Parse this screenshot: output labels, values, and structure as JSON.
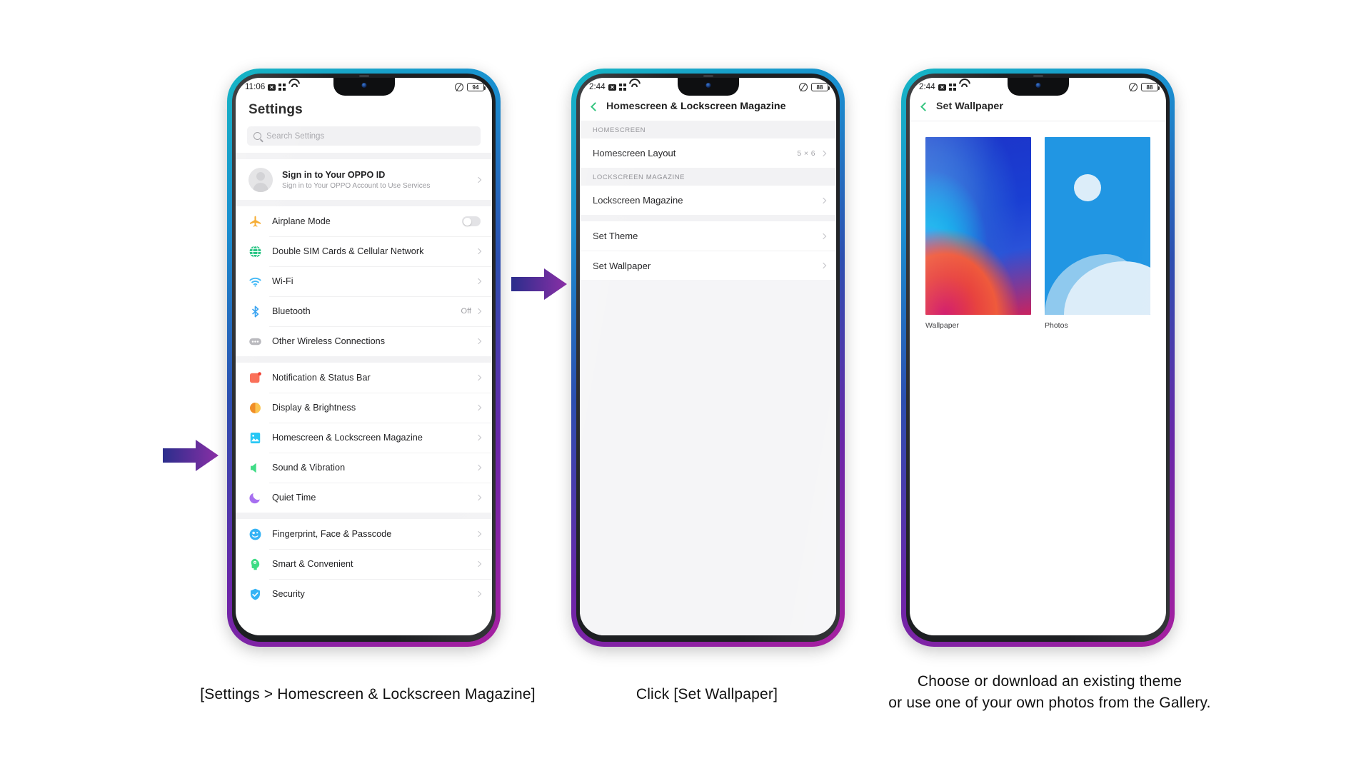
{
  "phones": [
    {
      "id": "phone-settings",
      "status": {
        "time": "11:06",
        "battery": "94",
        "icons": [
          "sms-icon",
          "qr-icon",
          "wifi-icon",
          "silent-mode-icon",
          "battery-icon"
        ]
      },
      "title": "Settings",
      "search": {
        "placeholder": "Search Settings"
      },
      "account": {
        "title": "Sign in to Your OPPO ID",
        "subtitle": "Sign in to Your OPPO Account to Use Services"
      },
      "groups": [
        {
          "items": [
            {
              "label": "Airplane Mode",
              "icon": "airplane-icon",
              "color": "#f5a623",
              "control": "toggle",
              "value": ""
            },
            {
              "label": "Double SIM Cards & Cellular Network",
              "icon": "globe-icon",
              "color": "#18c07a",
              "control": "chevron",
              "value": ""
            },
            {
              "label": "Wi-Fi",
              "icon": "wifi-icon",
              "color": "#35b3f5",
              "control": "chevron",
              "value": ""
            },
            {
              "label": "Bluetooth",
              "icon": "bluetooth-icon",
              "color": "#2f9ff0",
              "control": "chevron",
              "value": "Off"
            },
            {
              "label": "Other Wireless Connections",
              "icon": "dots-icon",
              "color": "#b6b6bb",
              "control": "chevron",
              "value": ""
            }
          ]
        },
        {
          "items": [
            {
              "label": "Notification & Status Bar",
              "icon": "notification-icon",
              "color": "#fa6a52",
              "control": "chevron",
              "value": ""
            },
            {
              "label": "Display & Brightness",
              "icon": "brightness-icon",
              "color": "#f5a623",
              "control": "chevron",
              "value": ""
            },
            {
              "label": "Homescreen & Lockscreen Magazine",
              "icon": "wallpaper-icon",
              "color": "#23c6f5",
              "control": "chevron",
              "value": ""
            },
            {
              "label": "Sound & Vibration",
              "icon": "sound-icon",
              "color": "#3ddc84",
              "control": "chevron",
              "value": ""
            },
            {
              "label": "Quiet Time",
              "icon": "moon-icon",
              "color": "#a66ef0",
              "control": "chevron",
              "value": ""
            }
          ]
        },
        {
          "items": [
            {
              "label": "Fingerprint, Face & Passcode",
              "icon": "fingerprint-face-icon",
              "color": "#35b3f5",
              "control": "chevron",
              "value": ""
            },
            {
              "label": "Smart & Convenient",
              "icon": "smart-head-icon",
              "color": "#3ddc84",
              "control": "chevron",
              "value": ""
            },
            {
              "label": "Security",
              "icon": "shield-icon",
              "color": "#35b3f5",
              "control": "chevron",
              "value": ""
            }
          ]
        }
      ]
    },
    {
      "id": "phone-homescreen-lockscreen",
      "status": {
        "time": "2:44",
        "battery": "88"
      },
      "nav_title": "Homescreen & Lockscreen Magazine",
      "sections": [
        {
          "header": "HOMESCREEN",
          "items": [
            {
              "label": "Homescreen Layout",
              "value": "5 × 6"
            }
          ]
        },
        {
          "header": "LOCKSCREEN MAGAZINE",
          "items": [
            {
              "label": "Lockscreen Magazine",
              "value": ""
            }
          ]
        },
        {
          "header": "",
          "items": [
            {
              "label": "Set Theme",
              "value": ""
            },
            {
              "label": "Set Wallpaper",
              "value": ""
            }
          ]
        }
      ]
    },
    {
      "id": "phone-set-wallpaper",
      "status": {
        "time": "2:44",
        "battery": "88"
      },
      "nav_title": "Set Wallpaper",
      "tiles": [
        {
          "caption": "Wallpaper",
          "style": "gradient-waves"
        },
        {
          "caption": "Photos",
          "style": "blue-landscape"
        }
      ]
    }
  ],
  "captions": [
    {
      "text": "[Settings > Homescreen & Lockscreen Magazine]"
    },
    {
      "text": "Click [Set Wallpaper]"
    },
    {
      "line1": "Choose or download an existing theme",
      "line2": "or use one of your own photos from the Gallery."
    }
  ],
  "colors": {
    "frame_gradient_start": "#16b6c4",
    "frame_gradient_end": "#a81fa0",
    "arrow_start": "#2b2e8c",
    "arrow_end": "#7b2d9e",
    "accent_green": "#18bd6e"
  }
}
